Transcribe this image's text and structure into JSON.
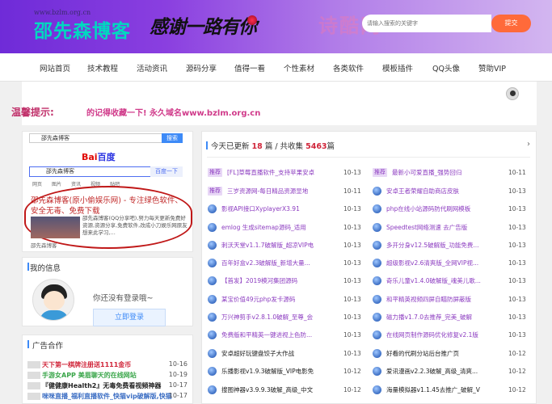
{
  "header": {
    "url": "www.bzlm.org.cn",
    "logo": "邵先森博客",
    "slogan": "感谢一路有你",
    "search_placeholder": "请输入搜索的关键字",
    "search_button": "提交"
  },
  "nav": [
    "网站首页",
    "技术教程",
    "活动资讯",
    "源码分享",
    "值得一看",
    "个性素材",
    "各类软件",
    "模板插件",
    "QQ头像",
    "赞助VIP"
  ],
  "notice": {
    "title": "温馨提示:",
    "text": "的记得收藏一下! 永久域名www.bzlm.org.cn"
  },
  "promo": {
    "search1_value": "邵先森博客",
    "search1_button": "搜索",
    "baidu_logo_a": "Bai",
    "baidu_logo_b": "百度",
    "search2_value": "邵先森博客",
    "search2_button": "百度一下",
    "tabs": [
      "网页",
      "图片",
      "资讯",
      "视频",
      "贴吧"
    ],
    "title": "邵先森博客(原小偷娱乐网) - 专注绿色软件、安全无毒、免费下载",
    "desc": "邵先森博客(QQ分享吧),努力每天更新免费好资源,资源分享,免费软件,改成小刀娱乐网原友想来此学习,...",
    "site": "邵先森博客"
  },
  "my_info": {
    "heading": "我的信息",
    "not_logged": "你还没有登录哦~",
    "login_button": "立即登录"
  },
  "ads": {
    "heading": "广告合作",
    "items": [
      {
        "title": "天下第一棋牌注册送1111金币",
        "date": "10-16",
        "color": "#d0263a"
      },
      {
        "title": "手游女APP 美眉聊天的在线网站",
        "date": "10-19",
        "color": "#3aa64a"
      },
      {
        "title": "『健健康Health2』无毒免费看视频神器",
        "date": "10-17",
        "color": "#222"
      },
      {
        "title": "咪咪直播_福利直播软件_快猫vip破解版,快猫",
        "date": "10-17",
        "color": "#3d6fc4"
      }
    ]
  },
  "updates": {
    "prefix": "今天已更新",
    "today": "18",
    "mid": "篇 / 共收集",
    "total": "5463",
    "suffix": "篇"
  },
  "list_left": [
    {
      "badge": "推荐",
      "title": "[FL]草莓直播软件_支持苹果安卓",
      "date": "10-13",
      "color": "#8c3cc0"
    },
    {
      "badge": "推荐",
      "title": "三岁资源网-每日精品资源显地",
      "date": "10-11",
      "color": "#8c3cc0"
    },
    {
      "badge": "",
      "title": "影视API接口XyplayerX3.91",
      "date": "10-13",
      "color": "#8c3cc0"
    },
    {
      "badge": "",
      "title": "emlog 生成sitemap源码_适用",
      "date": "10-13",
      "color": "#8c3cc0"
    },
    {
      "badge": "",
      "title": "刺沃天堂v1.1.7破解版_超凉VIP电",
      "date": "10-13",
      "color": "#8c3cc0"
    },
    {
      "badge": "",
      "title": "百年好盒v2.3破解版_新增大量...",
      "date": "10-13",
      "color": "#8c3cc0"
    },
    {
      "badge": "",
      "title": "【首发】2019模河集团源码",
      "date": "10-13",
      "color": "#8c3cc0"
    },
    {
      "badge": "",
      "title": "某宝价值49元php发卡源码",
      "date": "10-13",
      "color": "#8c3cc0"
    },
    {
      "badge": "",
      "title": "万兴神剪手v2.8.1.0破解_至尊_会",
      "date": "10-13",
      "color": "#8c3cc0"
    },
    {
      "badge": "",
      "title": "免费版和平精英一键进视上色防...",
      "date": "10-13",
      "color": "#8c3cc0"
    },
    {
      "badge": "",
      "title": "安卓超好玩键盘饺子大作战",
      "date": "10-13",
      "color": "#222"
    },
    {
      "badge": "",
      "title": "乐播影视v1.9.3破解版_VIP电影免",
      "date": "10-12",
      "color": "#222"
    },
    {
      "badge": "",
      "title": "搜图神器v3.9.9.3破解_高级_中文",
      "date": "10-12",
      "color": "#222"
    }
  ],
  "list_right": [
    {
      "badge": "推荐",
      "title": "最新小可爱直播_强势回归",
      "date": "10-11",
      "color": "#8c3cc0"
    },
    {
      "badge": "",
      "title": "安卓王者荣耀自助商店皮肤",
      "date": "10-13",
      "color": "#8c3cc0"
    },
    {
      "badge": "",
      "title": "php在线小站源码防代刷网模板",
      "date": "10-13",
      "color": "#8c3cc0"
    },
    {
      "badge": "",
      "title": "Speedtest网络测速 去广告版",
      "date": "10-13",
      "color": "#8c3cc0"
    },
    {
      "badge": "",
      "title": "多开分身v12.5破解版_功能免费...",
      "date": "10-13",
      "color": "#8c3cc0"
    },
    {
      "badge": "",
      "title": "超级影视v2.6清爽版_全网VIP视...",
      "date": "10-13",
      "color": "#8c3cc0"
    },
    {
      "badge": "",
      "title": "奇乐儿童v1.4.0破解版_魂美儿歌...",
      "date": "10-13",
      "color": "#8c3cc0"
    },
    {
      "badge": "",
      "title": "和平精英视频四屏自瞄防屏蔽版",
      "date": "10-13",
      "color": "#8c3cc0"
    },
    {
      "badge": "",
      "title": "磁力播v1.7.0去推荐_完美_破解",
      "date": "10-13",
      "color": "#8c3cc0"
    },
    {
      "badge": "",
      "title": "在线网页制作源码优化修复v2.1版",
      "date": "10-13",
      "color": "#8c3cc0"
    },
    {
      "badge": "",
      "title": "好看的代刷分站后台推广页",
      "date": "10-12",
      "color": "#222"
    },
    {
      "badge": "",
      "title": "爱讯漫画v2.2.3破解_高级_清爽...",
      "date": "10-12",
      "color": "#222"
    },
    {
      "badge": "",
      "title": "海量模拟器v1.1.45去推广_破解_V",
      "date": "10-12",
      "color": "#222"
    }
  ]
}
